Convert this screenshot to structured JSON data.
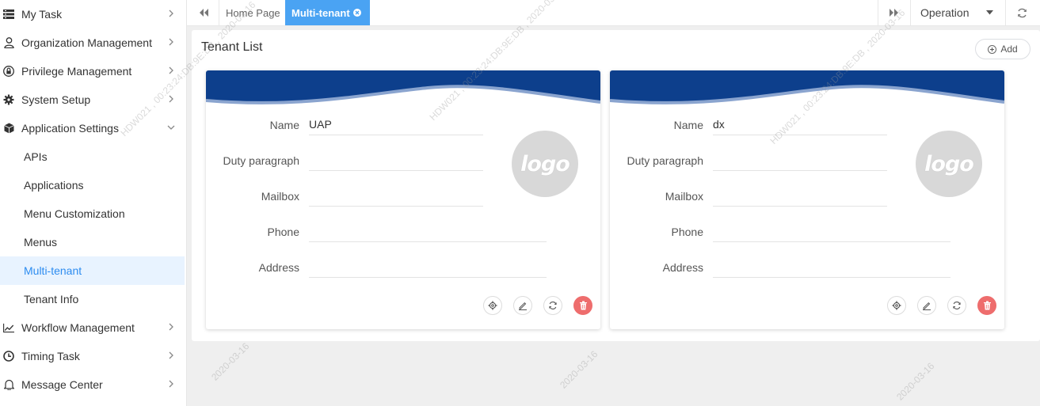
{
  "sidebar": {
    "items": [
      {
        "label": "My Task",
        "icon": "task-list-icon"
      },
      {
        "label": "Organization Management",
        "icon": "user-icon"
      },
      {
        "label": "Privilege Management",
        "icon": "lock-icon"
      },
      {
        "label": "System Setup",
        "icon": "gear-icon"
      },
      {
        "label": "Application Settings",
        "icon": "cube-icon",
        "expanded": true
      },
      {
        "label": "Workflow Management",
        "icon": "trend-chart-icon"
      },
      {
        "label": "Timing Task",
        "icon": "clock-icon"
      },
      {
        "label": "Message Center",
        "icon": "bell-icon"
      }
    ],
    "subitems": [
      {
        "label": "APIs"
      },
      {
        "label": "Applications"
      },
      {
        "label": "Menu Customization"
      },
      {
        "label": "Menus"
      },
      {
        "label": "Multi-tenant",
        "active": true
      },
      {
        "label": "Tenant Info"
      }
    ]
  },
  "tabs": {
    "home": "Home Page",
    "active": "Multi-tenant",
    "operation": "Operation"
  },
  "main": {
    "title": "Tenant List",
    "add_label": "Add",
    "field_labels": [
      "Name",
      "Duty paragraph",
      "Mailbox",
      "Phone",
      "Address"
    ],
    "tenants": [
      {
        "name": "UAP",
        "duty_paragraph": "",
        "mailbox": "",
        "phone": "",
        "address": "",
        "logo_text": "logo"
      },
      {
        "name": "dx",
        "duty_paragraph": "",
        "mailbox": "",
        "phone": "",
        "address": "",
        "logo_text": "logo"
      }
    ]
  },
  "watermark": {
    "text1": "HDW021 , 00:23:24:DB:9E:DB , 2020-03-16",
    "text2": "2020-03-16"
  },
  "colors": {
    "accent": "#4aa3f3",
    "active_bg": "#e8f3ff",
    "banner": "#0d3f8c",
    "delete": "#ee6d6d"
  }
}
